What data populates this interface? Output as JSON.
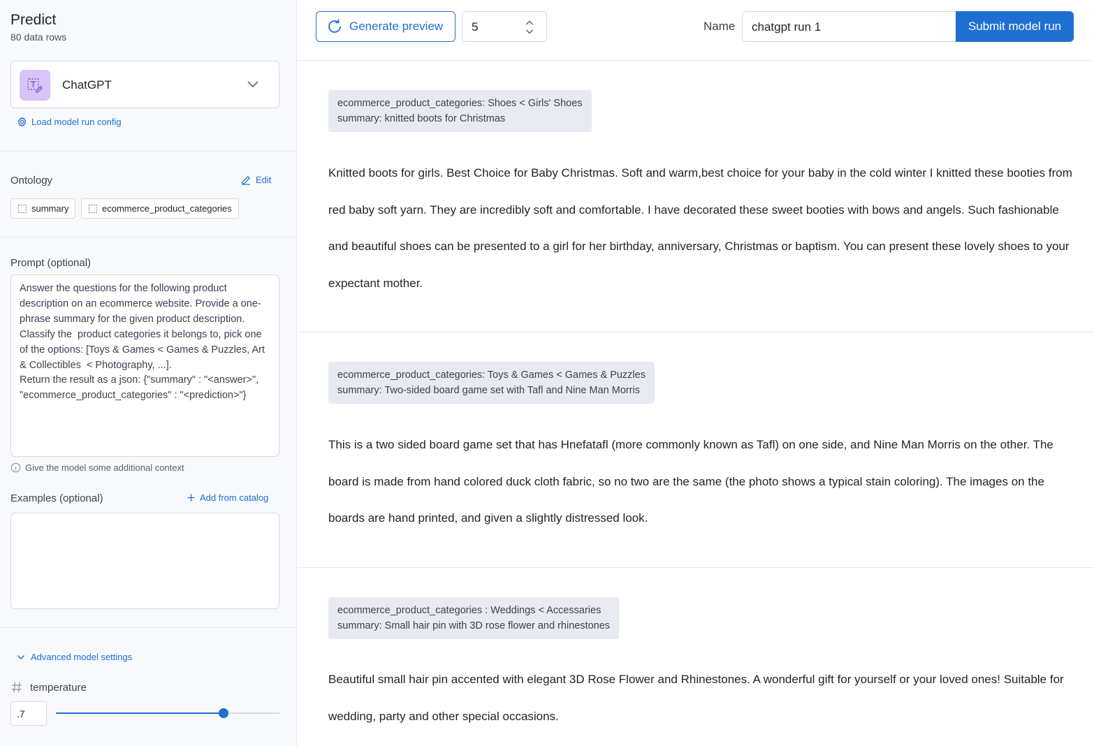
{
  "sidebar": {
    "title": "Predict",
    "subtitle": "80 data rows",
    "model": {
      "name": "ChatGPT"
    },
    "load_config_label": "Load model run config",
    "ontology": {
      "label": "Ontology",
      "edit_label": "Edit",
      "chips": [
        "summary",
        "ecommerce_product_categories"
      ]
    },
    "prompt": {
      "label": "Prompt (optional)",
      "value": "Answer the questions for the following product description on an ecommerce website. Provide a one-phrase summary for the given product description. Classify the  product categories it belongs to, pick one of the options: [Toys & Games < Games & Puzzles, Art & Collectibles  < Photography, ...].\nReturn the result as a json: {\"summary\" : \"<answer>\", \"ecommerce_product_categories\" : \"<prediction>\"}",
      "hint": "Give the model some additional context"
    },
    "examples": {
      "label": "Examples (optional)",
      "add_label": "Add from catalog"
    },
    "advanced": {
      "label": "Advanced model settings",
      "temperature_label": "temperature",
      "temperature_value": ".7",
      "temperature_fraction": 0.75
    }
  },
  "toolbar": {
    "generate_label": "Generate preview",
    "count": "5",
    "name_label": "Name",
    "name_value": "chatgpt run 1",
    "submit_label": "Submit model run"
  },
  "results": [
    {
      "category_line": "ecommerce_product_categories: Shoes < Girls' Shoes",
      "summary_line": "summary: knitted boots for Christmas",
      "description": "Knitted boots for girls. Best Choice for Baby Christmas. Soft and warm,best choice for your baby in the cold winter I knitted these booties from red baby soft yarn. They are incredibly soft and comfortable. I have decorated these sweet booties with bows and angels. Such fashionable and beautiful shoes can be presented to a girl for her birthday, anniversary, Christmas or baptism. You can present these lovely shoes to your expectant mother."
    },
    {
      "category_line": "ecommerce_product_categories: Toys & Games < Games & Puzzles",
      "summary_line": "summary: Two-sided board game set with Tafl and Nine Man Morris",
      "description": "This is a two sided board game set that has Hnefatafl (more commonly known as Tafl) on one side, and Nine Man Morris on the other. The board is made from hand colored duck cloth fabric, so no two are the same (the photo shows a typical stain coloring). The images on the boards are hand printed, and given a slightly distressed look."
    },
    {
      "category_line": "ecommerce_product_categories : Weddings < Accessaries",
      "summary_line": "summary: Small hair pin with 3D rose flower and rhinestones",
      "description": "Beautiful small hair pin accented with elegant 3D Rose Flower and Rhinestones. A wonderful gift for yourself or your loved ones! Suitable for wedding, party and other special occasions."
    }
  ],
  "colors": {
    "accent": "#1f6fd1",
    "model_icon_bg": "#d8c4f7"
  }
}
